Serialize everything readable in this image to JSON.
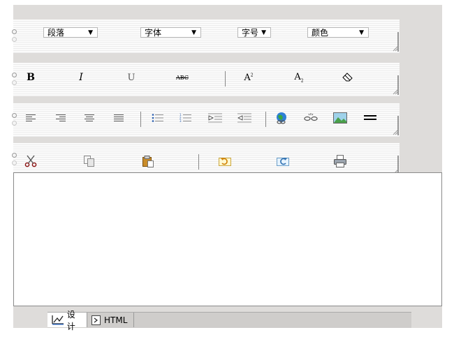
{
  "toolbar": {
    "paragraph_label": "段落",
    "font_label": "字体",
    "size_label": "字号",
    "color_label": "颜色",
    "dropdown_arrow": "▼"
  },
  "icons": {
    "bold": "B",
    "italic": "I",
    "underline": "U",
    "strikethrough": "ABC",
    "superscript": "A",
    "subscript": "A"
  },
  "tabs": {
    "design_label": "设计",
    "html_label": "HTML"
  }
}
